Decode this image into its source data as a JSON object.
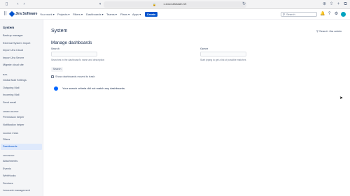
{
  "browser": {
    "url": "c-cloud.atlassian.net",
    "icons": [
      "sidebar-icon",
      "back-icon",
      "forward-icon",
      "shield-icon",
      "refresh-icon",
      "download-icon",
      "share-icon",
      "new-tab-icon",
      "tabs-icon"
    ]
  },
  "topnav": {
    "product": "Jira Software",
    "items": [
      "Your work ▾",
      "Projects ▾",
      "Filters ▾",
      "Dashboards ▾",
      "Teams ▾",
      "Plans ▾",
      "Apps ▾"
    ],
    "create_label": "Create",
    "search_placeholder": "Search",
    "brand_color": "#0052cc"
  },
  "sidebar": {
    "title": "System",
    "items_top": [
      "Backup manager",
      "External System Import",
      "Import Jira Cloud",
      "Import Jira Server",
      "Migrate cloud site"
    ],
    "group_mail": "MAIL",
    "items_mail": [
      "Global Mail Settings",
      "Outgoing Mail",
      "Incoming Mail",
      "Send email"
    ],
    "group_admin": "ADMIN HELPER",
    "items_admin": [
      "Permission helper",
      "Notification helper"
    ],
    "group_shared": "SHARED ITEMS",
    "items_shared": [
      "Filters",
      "Dashboards"
    ],
    "group_advanced": "ADVANCED",
    "items_advanced": [
      "Attachments",
      "Events",
      "WebHooks",
      "Services",
      "Lexorank management"
    ],
    "active_item": "Dashboards"
  },
  "main": {
    "page_title": "System",
    "admin_search": "Search Jira admin",
    "section_title": "Manage dashboards",
    "search_label": "Search",
    "search_help": "Searches in the dashboard's name and description",
    "owner_label": "Owner",
    "owner_help": "Start typing to get a list of possible matches",
    "search_button": "Search",
    "show_trash_label": "Show dashboards moved to trash",
    "empty_message": "Your search criteria did not match any dashboards."
  }
}
